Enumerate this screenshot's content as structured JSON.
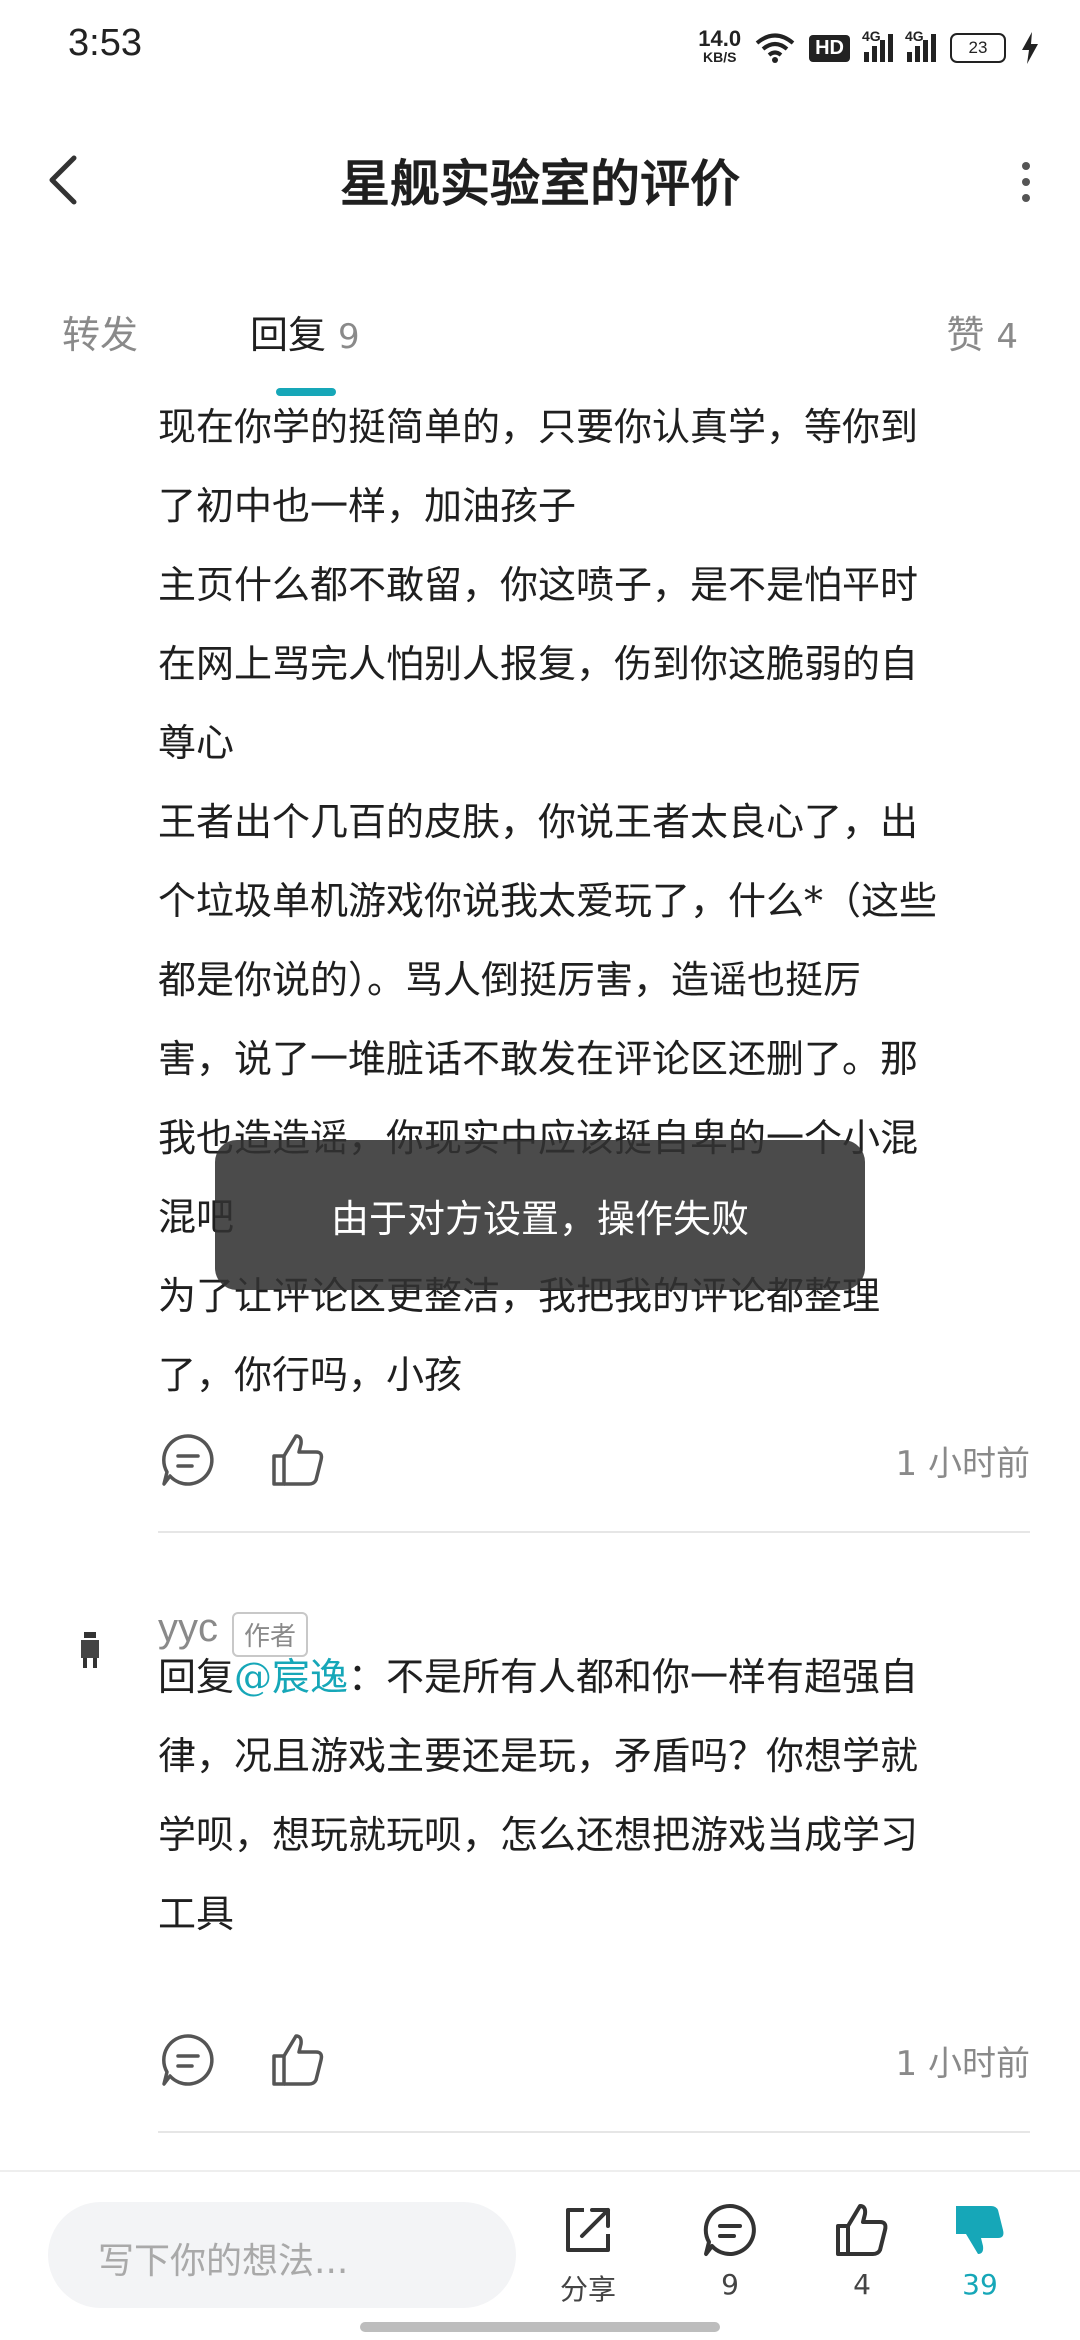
{
  "status_bar": {
    "time": "3:53",
    "net_speed": "14.0",
    "net_unit": "KB/S",
    "hd": "HD",
    "signal1": "4G",
    "signal2": "4G",
    "battery": "23"
  },
  "header": {
    "title": "星舰实验室的评价"
  },
  "tabs": {
    "forward": "转发",
    "reply": "回复",
    "reply_count": "9",
    "likes": "赞",
    "likes_count": "4"
  },
  "comment1": {
    "lines": [
      "现在你学的挺简单的，只要你认真学，等你到",
      "了初中也一样，加油孩子",
      "主页什么都不敢留，你这喷子，是不是怕平时",
      "在网上骂完人怕别人报复，伤到你这脆弱的自",
      "尊心",
      "王者出个几百的皮肤，你说王者太良心了，出",
      "个垃圾单机游戏你说我太爱玩了，什么*（这些",
      "都是你说的）。骂人倒挺厉害，造谣也挺厉",
      "害，说了一堆脏话不敢发在评论区还删了。那",
      "我也造造谣，你现实中应该挺自卑的一个小混",
      "混吧",
      "为了让评论区更整洁，我把我的评论都整理",
      "了，你行吗，小孩"
    ],
    "time": "1 小时前"
  },
  "toast": {
    "text": "由于对方设置，操作失败"
  },
  "comment2": {
    "username": "yyc",
    "badge": "作者",
    "reply_prefix": "回复",
    "mention": "@宸逸",
    "line1_rest": "：不是所有人都和你一样有超强自",
    "lines": [
      "律，况且游戏主要还是玩，矛盾吗？你想学就",
      "学呗，想玩就玩呗，怎么还想把游戏当成学习",
      "工具"
    ],
    "time": "1 小时前"
  },
  "bottom_bar": {
    "input_placeholder": "写下你的想法...",
    "share_label": "分享",
    "comment_count": "9",
    "like_count": "4",
    "dislike_count": "39",
    "accent_color": "#16a7b8"
  }
}
